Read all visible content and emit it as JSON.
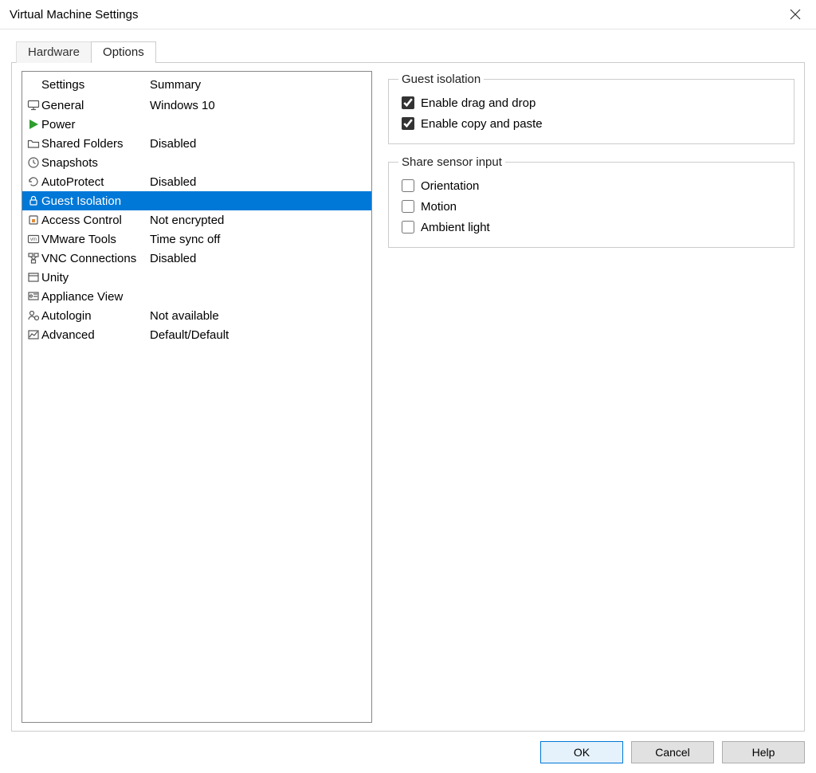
{
  "window": {
    "title": "Virtual Machine Settings"
  },
  "tabs": [
    {
      "label": "Hardware",
      "active": false
    },
    {
      "label": "Options",
      "active": true
    }
  ],
  "settings_list": {
    "header_settings": "Settings",
    "header_summary": "Summary",
    "items": [
      {
        "icon": "monitor-icon",
        "name": "General",
        "summary": "Windows 10",
        "selected": false
      },
      {
        "icon": "play-icon",
        "name": "Power",
        "summary": "",
        "selected": false
      },
      {
        "icon": "folder-icon",
        "name": "Shared Folders",
        "summary": "Disabled",
        "selected": false
      },
      {
        "icon": "clock-icon",
        "name": "Snapshots",
        "summary": "",
        "selected": false
      },
      {
        "icon": "history-icon",
        "name": "AutoProtect",
        "summary": "Disabled",
        "selected": false
      },
      {
        "icon": "lock-icon",
        "name": "Guest Isolation",
        "summary": "",
        "selected": true
      },
      {
        "icon": "shield-icon",
        "name": "Access Control",
        "summary": "Not encrypted",
        "selected": false
      },
      {
        "icon": "vm-icon",
        "name": "VMware Tools",
        "summary": "Time sync off",
        "selected": false
      },
      {
        "icon": "network-icon",
        "name": "VNC Connections",
        "summary": "Disabled",
        "selected": false
      },
      {
        "icon": "window-icon",
        "name": "Unity",
        "summary": "",
        "selected": false
      },
      {
        "icon": "appliance-icon",
        "name": "Appliance View",
        "summary": "",
        "selected": false
      },
      {
        "icon": "user-icon",
        "name": "Autologin",
        "summary": "Not available",
        "selected": false
      },
      {
        "icon": "chart-icon",
        "name": "Advanced",
        "summary": "Default/Default",
        "selected": false
      }
    ]
  },
  "guest_isolation": {
    "legend": "Guest isolation",
    "drag_drop": {
      "label": "Enable drag and drop",
      "checked": true
    },
    "copy_paste": {
      "label": "Enable copy and paste",
      "checked": true
    }
  },
  "share_sensor": {
    "legend": "Share sensor input",
    "orientation": {
      "label": "Orientation",
      "checked": false
    },
    "motion": {
      "label": "Motion",
      "checked": false
    },
    "ambient_light": {
      "label": "Ambient light",
      "checked": false
    }
  },
  "footer": {
    "ok": "OK",
    "cancel": "Cancel",
    "help": "Help"
  }
}
